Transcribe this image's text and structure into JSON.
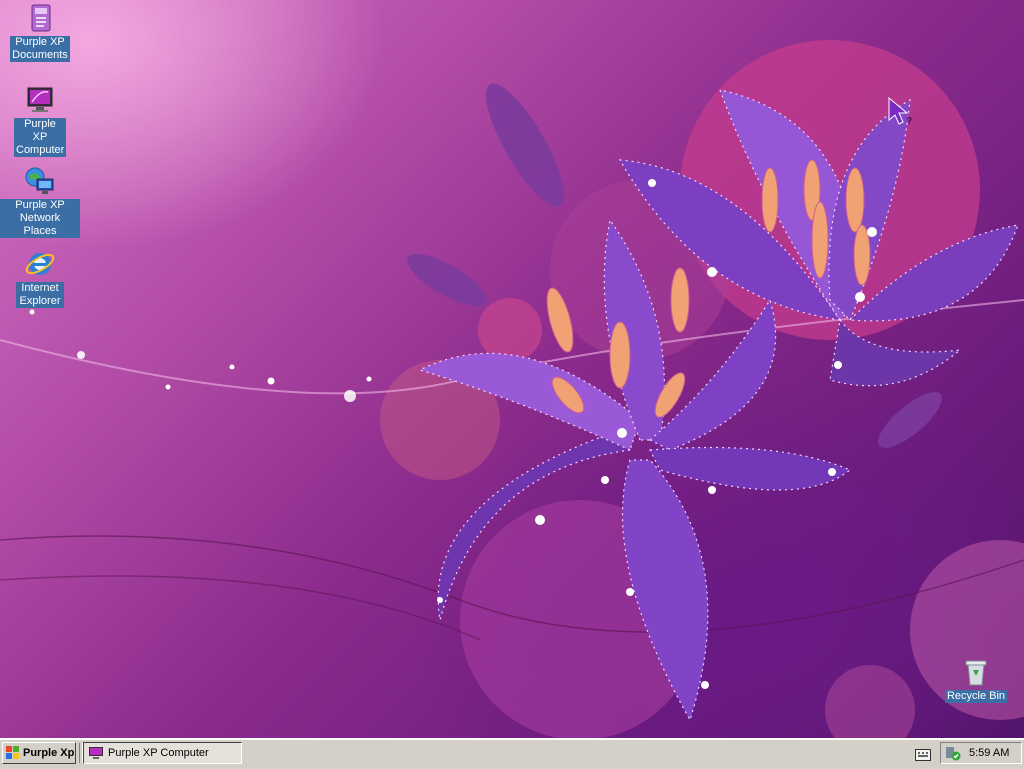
{
  "desktop": {
    "icons": [
      {
        "label": "Purple XP Documents",
        "icon": "documents-icon"
      },
      {
        "label": "Purple XP Computer",
        "icon": "computer-icon"
      },
      {
        "label": "Purple XP Network Places",
        "icon": "network-places-icon"
      },
      {
        "label": "Internet Explorer",
        "icon": "internet-explorer-icon"
      },
      {
        "label": "Recycle Bin",
        "icon": "recycle-bin-icon"
      }
    ],
    "wallpaper_colors": {
      "primary": "#8c2b8c",
      "light": "#e89ad8",
      "flower": "#8a4ccf"
    }
  },
  "taskbar": {
    "start_label": "Purple Xp",
    "tasks": [
      {
        "label": "Purple XP Computer"
      }
    ],
    "clock": "5:59 AM"
  }
}
